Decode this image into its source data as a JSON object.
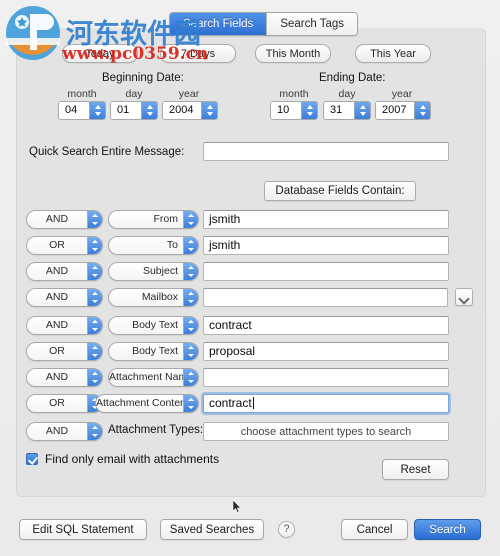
{
  "window": {
    "background_color": "#f0f0f0",
    "panel_color": "#e3e3e3"
  },
  "watermark": {
    "chinese_text": "河东软件园",
    "url_text": "www.pc0359.cn",
    "logo_name": "site-logo",
    "chinese_color": "#2f7fd0",
    "url_color": "#d7241a"
  },
  "tabs": [
    {
      "label": "Search Fields",
      "selected": true
    },
    {
      "label": "Search Tags",
      "selected": false
    }
  ],
  "quick_dates": [
    {
      "label": "Today"
    },
    {
      "label": "7 Days"
    },
    {
      "label": "This Month"
    },
    {
      "label": "This Year"
    }
  ],
  "date_ranges": {
    "beginning": {
      "title": "Beginning Date:",
      "month_label": "month",
      "day_label": "day",
      "year_label": "year",
      "month": "04",
      "day": "01",
      "year": "2004"
    },
    "ending": {
      "title": "Ending Date:",
      "month_label": "month",
      "day_label": "day",
      "year_label": "year",
      "month": "10",
      "day": "31",
      "year": "2007"
    }
  },
  "quick_search": {
    "label": "Quick Search Entire Message:",
    "value": "",
    "placeholder": ""
  },
  "database_fields_header": "Database Fields Contain:",
  "criteria_rows": [
    {
      "bool": "AND",
      "field": "From",
      "value": "jsmith",
      "focused": false,
      "has_chevron": false
    },
    {
      "bool": "OR",
      "field": "To",
      "value": "jsmith",
      "focused": false,
      "has_chevron": false
    },
    {
      "bool": "AND",
      "field": "Subject",
      "value": "",
      "focused": false,
      "has_chevron": false
    },
    {
      "bool": "AND",
      "field": "Mailbox",
      "value": "",
      "focused": false,
      "has_chevron": true
    },
    {
      "bool": "AND",
      "field": "Body Text",
      "value": "contract",
      "focused": false,
      "has_chevron": false
    },
    {
      "bool": "OR",
      "field": "Body Text",
      "value": "proposal",
      "focused": false,
      "has_chevron": false
    },
    {
      "bool": "AND",
      "field": "Attachment Name",
      "value": "",
      "focused": false,
      "has_chevron": false
    },
    {
      "bool": "OR",
      "field": "Attachment Contents",
      "value": "contract",
      "focused": true,
      "has_chevron": false
    }
  ],
  "attachment_types_row": {
    "bool": "AND",
    "label": "Attachment Types:",
    "placeholder": "choose attachment types to search"
  },
  "attachments_checkbox": {
    "label": "Find only email with attachments",
    "checked": true
  },
  "reset_button": "Reset",
  "bottom_bar": {
    "edit_sql": "Edit SQL Statement",
    "saved_searches": "Saved Searches",
    "help": "?",
    "cancel": "Cancel",
    "search": "Search",
    "accent_color": "#2a6cd2"
  }
}
